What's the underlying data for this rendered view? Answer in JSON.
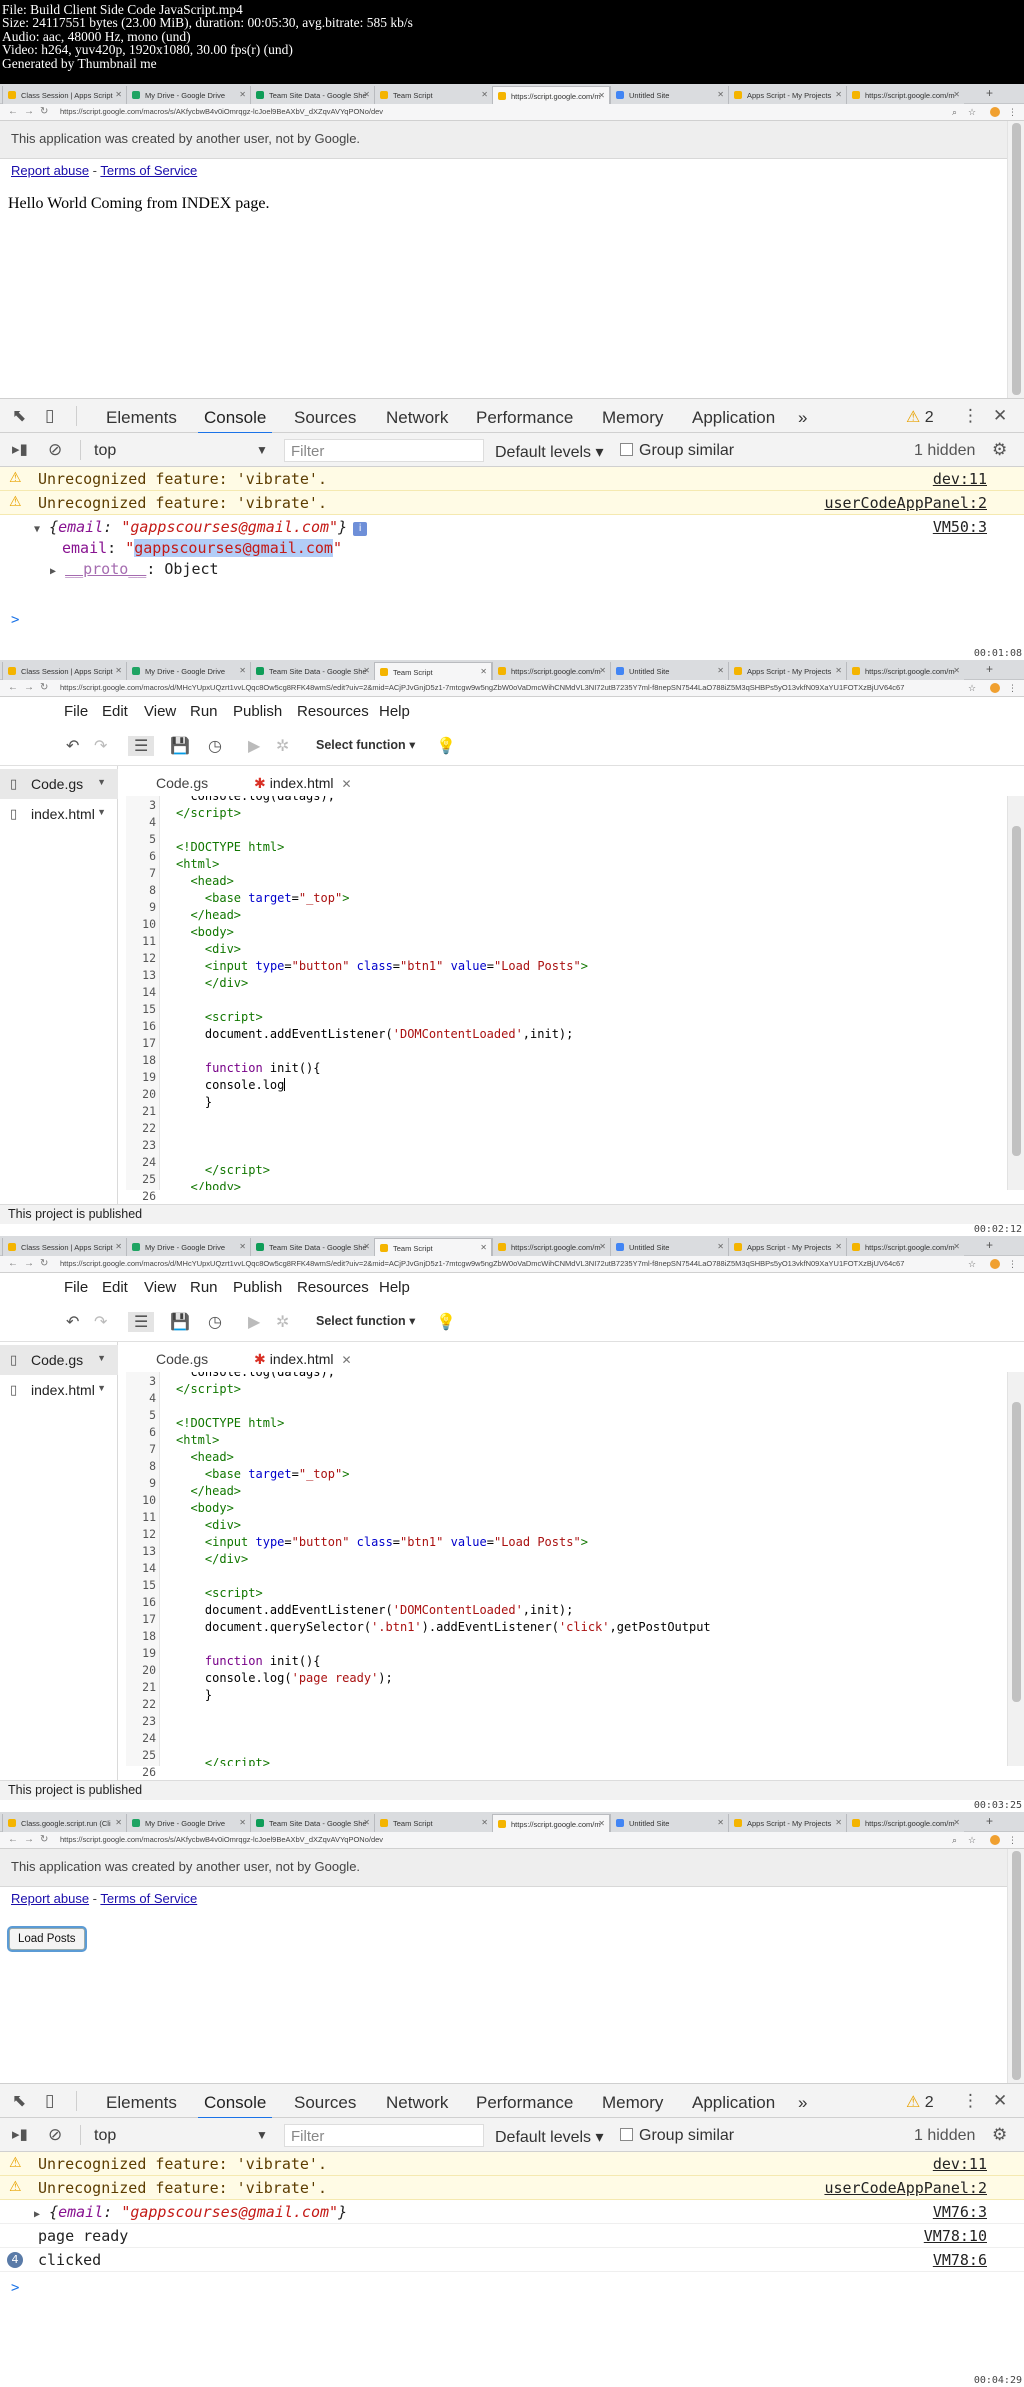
{
  "meta": {
    "file": "File: Build Client Side Code JavaScript.mp4",
    "size": "Size: 24117551 bytes (23.00 MiB), duration: 00:05:30, avg.bitrate: 585 kb/s",
    "audio": "Audio: aac, 48000 Hz, mono (und)",
    "video": "Video: h264, yuv420p, 1920x1080, 30.00 fps(r) (und)",
    "generated": "Generated by Thumbnail me"
  },
  "timestamps": [
    "00:01:08",
    "00:02:12",
    "00:03:25",
    "00:04:29"
  ],
  "tabs_webapp": [
    "Class Session | Apps Script",
    "My Drive - Google Drive",
    "Team Site Data - Google She",
    "Team Script",
    "https://script.google.com/m",
    "Untitled Site",
    "Apps Script - My Projects",
    "https://script.google.com/m"
  ],
  "tabs_webapp2": [
    "Class.google.script.run (Cli",
    "My Drive - Google Drive",
    "Team Site Data - Google She",
    "Team Script",
    "https://script.google.com/m",
    "Untitled Site",
    "Apps Script - My Projects",
    "https://script.google.com/m"
  ],
  "tabs_editor": [
    "Class Session | Apps Script",
    "My Drive - Google Drive",
    "Team Site Data - Google She",
    "Team Script",
    "https://script.google.com/m",
    "Untitled Site",
    "Apps Script - My Projects",
    "https://script.google.com/m"
  ],
  "url_webapp": "https://script.google.com/macros/s/AKfycbwB4v0iOmrqgz-lcJoel9BeAXbV_dXZqvAVYqPONo/dev",
  "url_editor": "https://script.google.com/macros/d/MHcYUpxUQzrt1vvLQqc8Ow5cg8RFK48wmS/edit?uiv=2&mid=ACjPJvGnjD5z1-7mtcgw9w5ngZbW0oVaDmcWihCNMdVL3NI72utB7235Y7ml-f8nepSN7544LaO788iZ5M3qSHBPs5yO13vkfN09XaYU1FOTXzBjUV64c67",
  "gas": {
    "banner": "This application was created by another user, not by Google.",
    "report_abuse": "Report abuse",
    "separator": " - ",
    "terms": "Terms of Service",
    "hello": "Hello World Coming from INDEX page.",
    "load_posts": "Load Posts"
  },
  "devtools": {
    "tabs": [
      "Elements",
      "Console",
      "Sources",
      "Network",
      "Performance",
      "Memory",
      "Application"
    ],
    "more": "»",
    "warn_count": "2",
    "context": "top",
    "filter_placeholder": "Filter",
    "levels": "Default levels",
    "group_similar": "Group similar",
    "hidden": "1 hidden",
    "prompt": ">"
  },
  "console1": {
    "warn1": "Unrecognized feature: 'vibrate'.",
    "warn1_src": "dev:11",
    "warn2": "Unrecognized feature: 'vibrate'.",
    "warn2_src": "userCodeAppPanel:2",
    "obj_src": "VM50:3",
    "obj_summary_open": "{",
    "obj_key": "email",
    "obj_colon": ": ",
    "obj_value": "\"gappscourses@gmail.com\"",
    "obj_summary_close": "}",
    "email_key": "email",
    "email_val_pre": "\"",
    "email_val_hl": "gappscourses@gmail.com",
    "email_val_post": "\"",
    "proto_key": "__proto__",
    "proto_val": ": Object"
  },
  "console2": {
    "warn1": "Unrecognized feature: 'vibrate'.",
    "warn1_src": "dev:11",
    "warn2": "Unrecognized feature: 'vibrate'.",
    "warn2_src": "userCodeAppPanel:2",
    "obj_src": "VM76:3",
    "page_ready": "page ready",
    "page_ready_src": "VM78:10",
    "clicked_count": "4",
    "clicked": "clicked",
    "clicked_src": "VM78:6"
  },
  "editor": {
    "menu": [
      "File",
      "Edit",
      "View",
      "Run",
      "Publish",
      "Resources",
      "Help"
    ],
    "select_function": "Select function",
    "files": [
      "Code.gs",
      "index.html"
    ],
    "tabs": [
      "Code.gs",
      "index.html"
    ],
    "published": "This project is published"
  }
}
